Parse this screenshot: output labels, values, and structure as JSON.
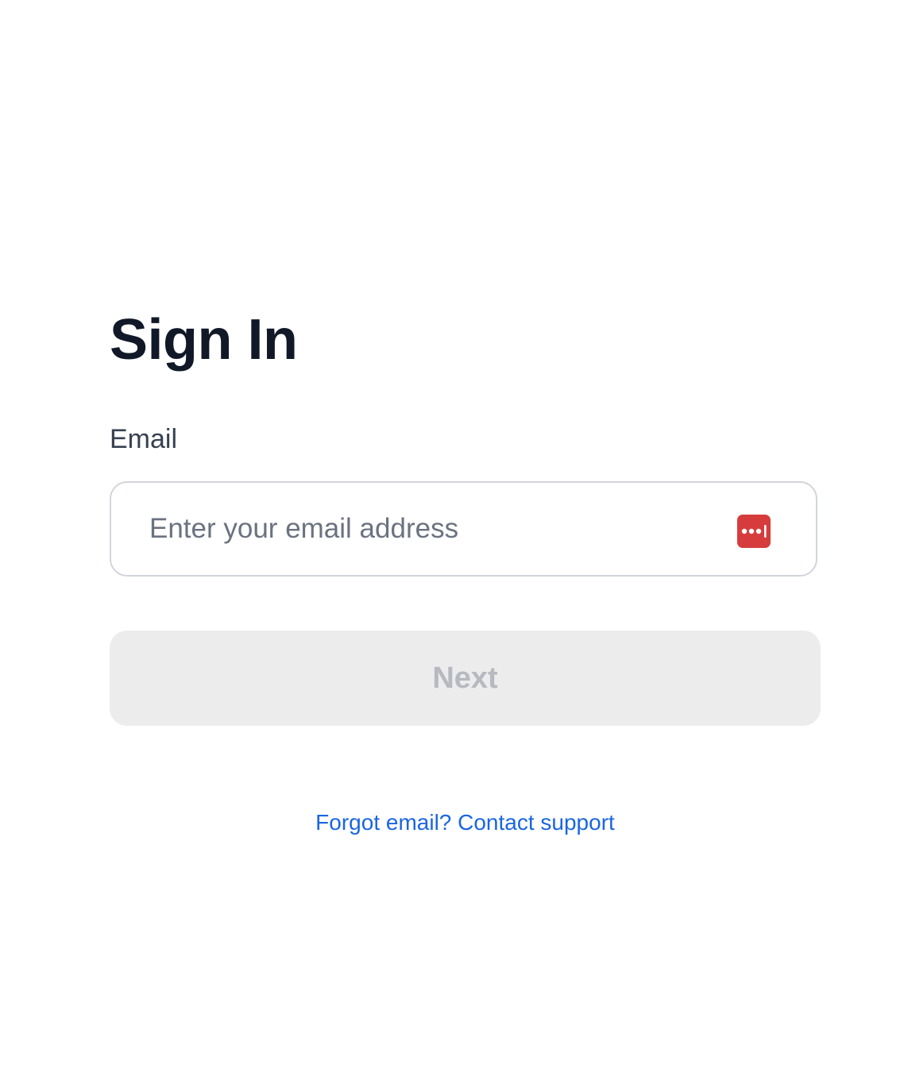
{
  "page": {
    "title": "Sign In"
  },
  "email": {
    "label": "Email",
    "placeholder": "Enter your email address",
    "value": ""
  },
  "password_manager_icon": {
    "name": "password-manager-icon",
    "color": "#d63c3c"
  },
  "actions": {
    "next_label": "Next"
  },
  "links": {
    "forgot": "Forgot email? Contact support",
    "color": "#1a66e0"
  }
}
